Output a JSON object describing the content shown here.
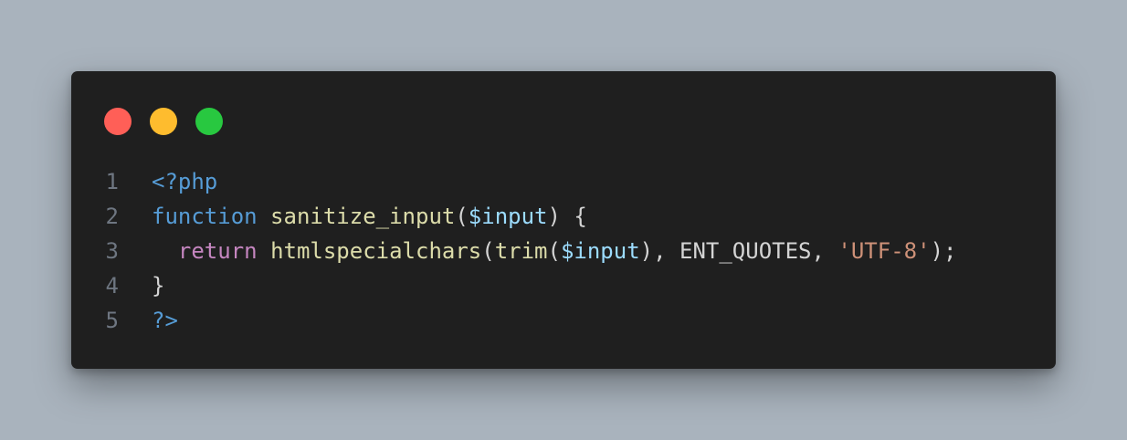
{
  "window": {
    "controls": [
      {
        "name": "close",
        "color": "#ff5f57"
      },
      {
        "name": "minimize",
        "color": "#febc2e"
      },
      {
        "name": "zoom",
        "color": "#28c840"
      }
    ]
  },
  "code": {
    "lines": [
      {
        "number": "1",
        "tokens": [
          {
            "text": "<?php",
            "kind": "tag"
          }
        ]
      },
      {
        "number": "2",
        "tokens": [
          {
            "text": "function",
            "kind": "keyword"
          },
          {
            "text": " ",
            "kind": "plain"
          },
          {
            "text": "sanitize_input",
            "kind": "func"
          },
          {
            "text": "(",
            "kind": "plain"
          },
          {
            "text": "$input",
            "kind": "var"
          },
          {
            "text": ") {",
            "kind": "plain"
          }
        ]
      },
      {
        "number": "3",
        "tokens": [
          {
            "text": "  ",
            "kind": "plain"
          },
          {
            "text": "return",
            "kind": "return"
          },
          {
            "text": " ",
            "kind": "plain"
          },
          {
            "text": "htmlspecialchars",
            "kind": "func"
          },
          {
            "text": "(",
            "kind": "plain"
          },
          {
            "text": "trim",
            "kind": "func"
          },
          {
            "text": "(",
            "kind": "plain"
          },
          {
            "text": "$input",
            "kind": "var"
          },
          {
            "text": "), ENT_QUOTES, ",
            "kind": "plain"
          },
          {
            "text": "'UTF-8'",
            "kind": "string"
          },
          {
            "text": ");",
            "kind": "plain"
          }
        ]
      },
      {
        "number": "4",
        "tokens": [
          {
            "text": "}",
            "kind": "plain"
          }
        ]
      },
      {
        "number": "5",
        "tokens": [
          {
            "text": "?>",
            "kind": "tag"
          }
        ]
      }
    ]
  }
}
